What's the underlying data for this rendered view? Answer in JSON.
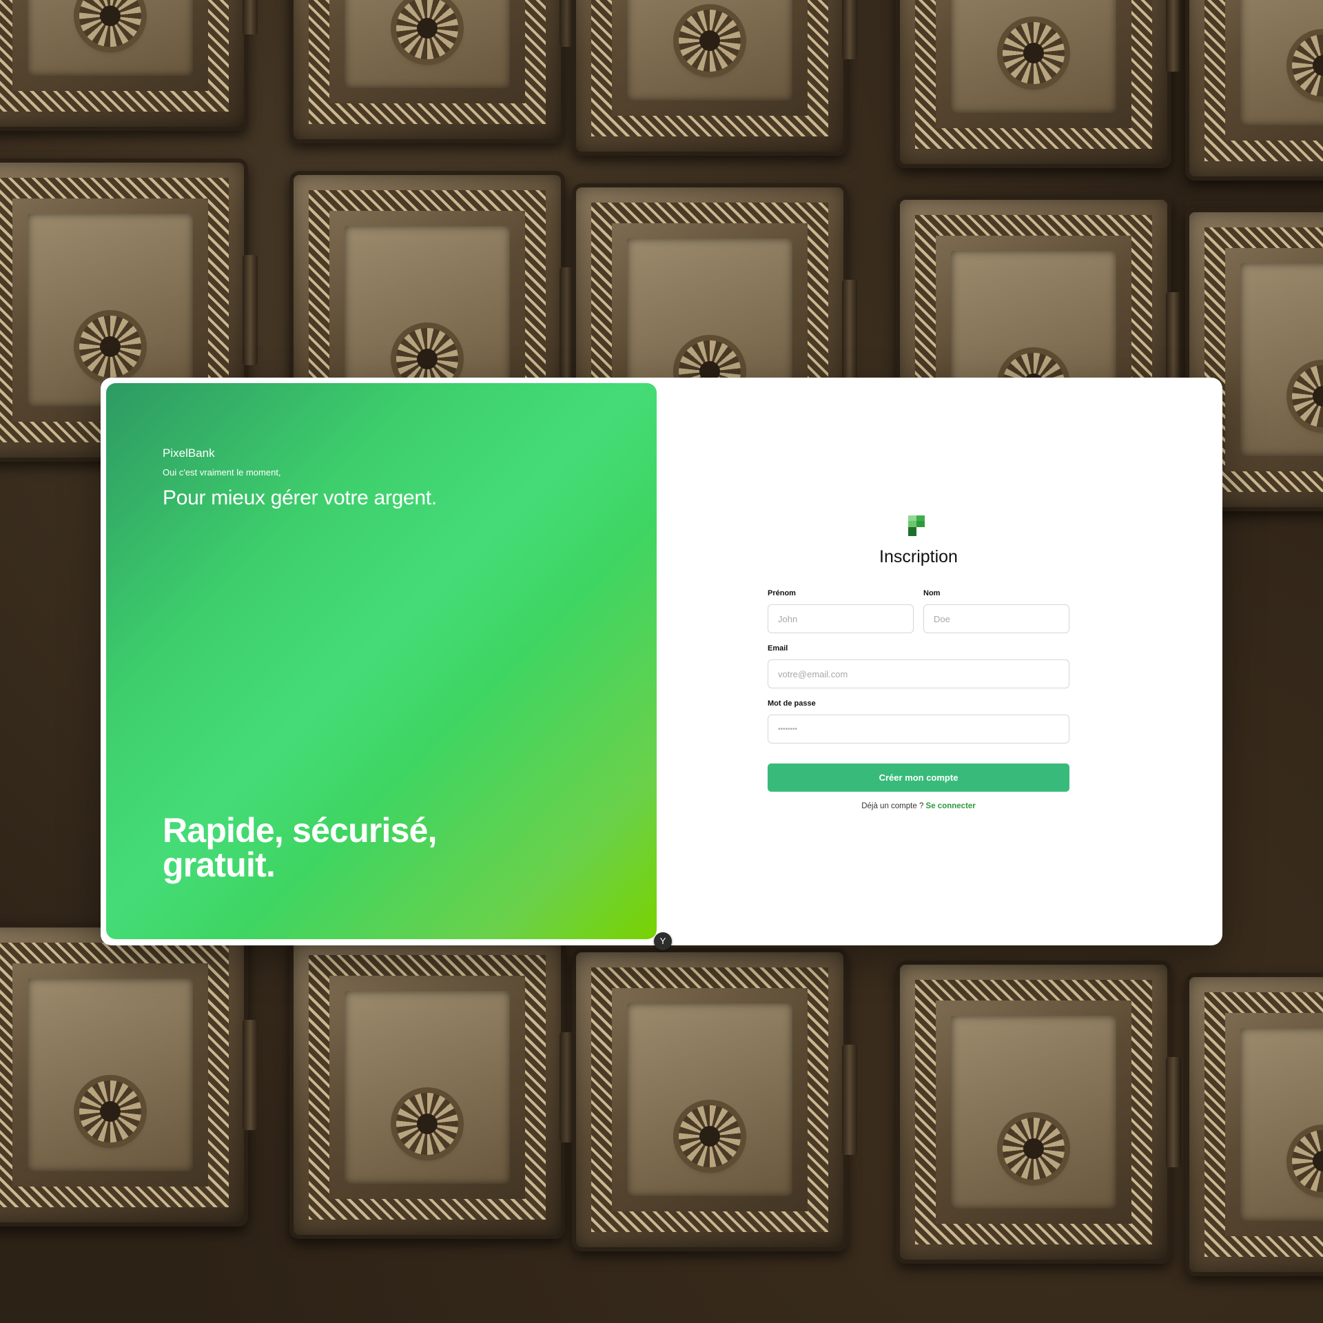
{
  "brand": {
    "name": "PixelBank",
    "tagline_small": "Oui c'est vraiment le moment,",
    "tagline_big": "Pour mieux gérer votre argent.",
    "slogan_line1": "Rapide, sécurisé,",
    "slogan_line2": "gratuit."
  },
  "form": {
    "title": "Inscription",
    "first_name": {
      "label": "Prénom",
      "placeholder": "John",
      "value": ""
    },
    "last_name": {
      "label": "Nom",
      "placeholder": "Doe",
      "value": ""
    },
    "email": {
      "label": "Email",
      "placeholder": "votre@email.com",
      "value": ""
    },
    "password": {
      "label": "Mot de passe",
      "placeholder": "••••••••",
      "value": ""
    },
    "submit_label": "Créer mon compte",
    "login_prompt": "Déjà un compte ?",
    "login_link": "Se connecter"
  },
  "toggle": {
    "glyph": "Y"
  },
  "colors": {
    "accent": "#38bb7a",
    "link": "#2c9a3e",
    "hero_gradient_start": "#2e9a63",
    "hero_gradient_end": "#79d200"
  },
  "icons": {
    "logo": "pixelbank-logo-icon",
    "background": "safe-deposit-boxes-photo"
  }
}
